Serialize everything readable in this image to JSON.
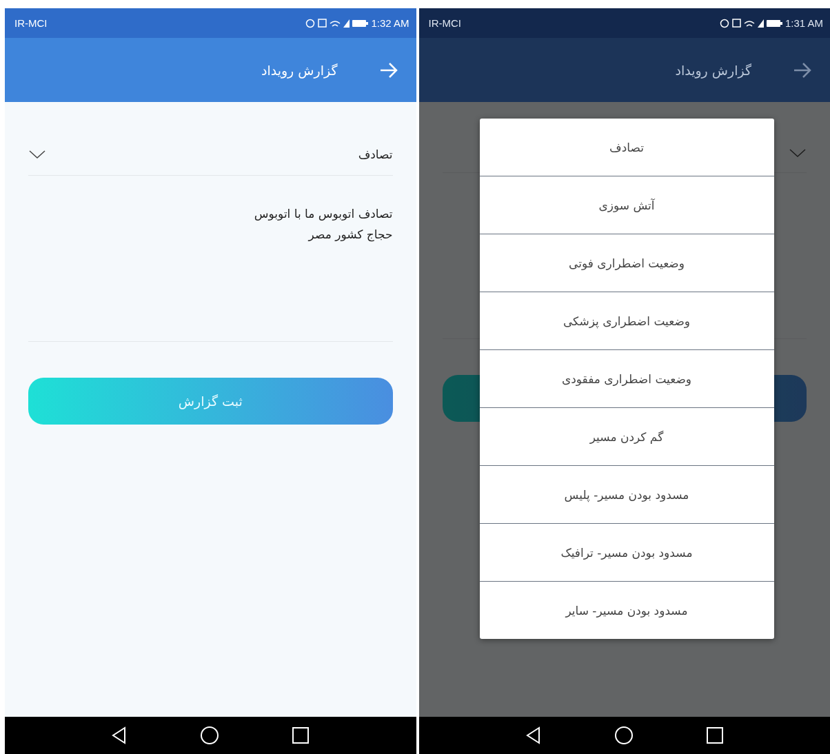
{
  "screens": [
    {
      "dimmed": true,
      "status_bar": {
        "carrier": "IR-MCI",
        "time": "1:31 AM"
      },
      "app_bar": {
        "title": "گزارش رویداد"
      },
      "dialog": {
        "options": [
          "تصادف",
          "آتش سوزی",
          "وضعیت اضطراری فوتی",
          "وضعیت اضطراری پزشکی",
          "وضعیت اضطراری مفقودی",
          "گم کردن مسیر",
          "مسدود بودن مسیر- پلیس",
          "مسدود بودن مسیر- ترافیک",
          "مسدود بودن مسیر- سایر"
        ]
      }
    },
    {
      "dimmed": false,
      "status_bar": {
        "carrier": "IR-MCI",
        "time": "1:32 AM"
      },
      "app_bar": {
        "title": "گزارش رویداد"
      },
      "form": {
        "incident_type": "تصادف",
        "description": "تصادف اتوبوس ما با اتوبوس\nحجاج کشور مصر",
        "submit": "ثبت گزارش"
      }
    }
  ]
}
